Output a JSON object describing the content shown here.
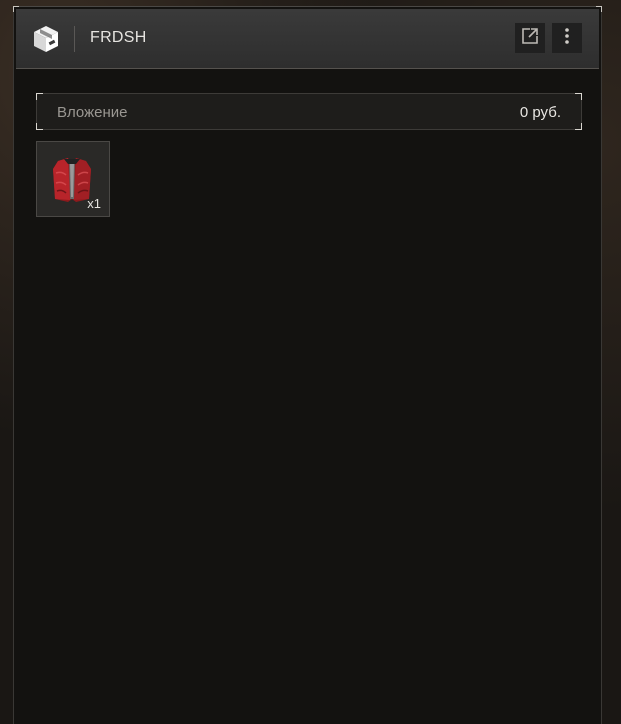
{
  "header": {
    "title": "FRDSH",
    "icon": "box-icon",
    "open_icon": "external-link-icon",
    "more_icon": "more-vertical-icon"
  },
  "value_bar": {
    "label": "Вложение",
    "value": "0 руб."
  },
  "items": [
    {
      "icon": "red-jacket-icon",
      "count": "x1"
    }
  ],
  "colors": {
    "panel_bg": "#131210",
    "header_bg": "#343434",
    "accent_text": "#e6e4e0",
    "muted_text": "#9a9792",
    "item_red": "#b01f24"
  }
}
